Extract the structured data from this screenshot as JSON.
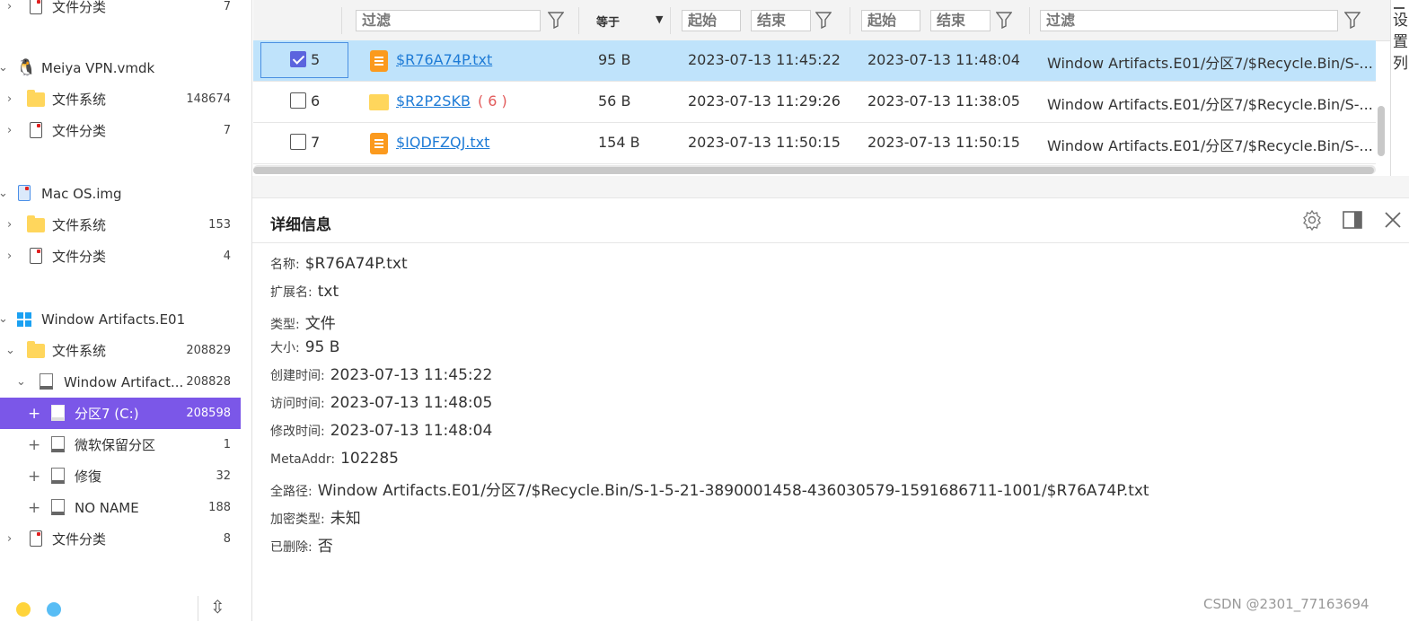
{
  "sidebar": {
    "items": [
      {
        "label": "文件分类",
        "count": "7"
      },
      {
        "label": "Meiya VPN.vmdk"
      },
      {
        "label": "文件系统",
        "count": "148674"
      },
      {
        "label": "文件分类",
        "count": "7"
      },
      {
        "label": "Mac OS.img"
      },
      {
        "label": "文件系统",
        "count": "153"
      },
      {
        "label": "文件分类",
        "count": "4"
      },
      {
        "label": "Window Artifacts.E01"
      },
      {
        "label": "文件系统",
        "count": "208829"
      },
      {
        "label": "Window Artifact...",
        "count": "208828"
      },
      {
        "label": "分区7  (C:)",
        "count": "208598"
      },
      {
        "label": "微软保留分区",
        "count": "1"
      },
      {
        "label": "修復",
        "count": "32"
      },
      {
        "label": "NO NAME",
        "count": "188"
      },
      {
        "label": "文件分类",
        "count": "8"
      }
    ],
    "expand_plus": "+",
    "collapse_icon": "⇳"
  },
  "filters": {
    "name_placeholder": "过滤",
    "size_op": "等于",
    "created_start": "起始",
    "created_end": "结束",
    "accessed_start": "起始",
    "accessed_end": "结束",
    "path_placeholder": "过滤"
  },
  "rows": [
    {
      "index": "5",
      "name": "$R76A74P.txt",
      "badge": "",
      "size": "95 B",
      "created": "2023-07-13 11:45:22",
      "modified": "2023-07-13 11:48:04",
      "path": "Window Artifacts.E01/分区7/$Recycle.Bin/S-..."
    },
    {
      "index": "6",
      "name": "$R2P2SKB",
      "badge": "( 6 )",
      "size": "56 B",
      "created": "2023-07-13 11:29:26",
      "modified": "2023-07-13 11:38:05",
      "path": "Window Artifacts.E01/分区7/$Recycle.Bin/S-..."
    },
    {
      "index": "7",
      "name": "$IQDFZQJ.txt",
      "badge": "",
      "size": "154 B",
      "created": "2023-07-13 11:50:15",
      "modified": "2023-07-13 11:50:15",
      "path": "Window Artifacts.E01/分区7/$Recycle.Bin/S-..."
    }
  ],
  "right_panel": {
    "chars": [
      "设",
      "置",
      "列"
    ]
  },
  "detail": {
    "title": "详细信息",
    "fields": [
      {
        "k": "名称:",
        "v": "$R76A74P.txt"
      },
      {
        "k": "扩展名:",
        "v": "txt"
      },
      {
        "k": "类型:",
        "v": "文件"
      },
      {
        "k": "大小:",
        "v": "95 B"
      },
      {
        "k": "创建时间:",
        "v": "2023-07-13 11:45:22"
      },
      {
        "k": "访问时间:",
        "v": "2023-07-13 11:48:05"
      },
      {
        "k": "修改时间:",
        "v": "2023-07-13 11:48:04"
      },
      {
        "k": "MetaAddr:",
        "v": "102285"
      },
      {
        "k": "全路径:",
        "v": "Window Artifacts.E01/分区7/$Recycle.Bin/S-1-5-21-3890001458-436030579-1591686711-1001/$R76A74P.txt"
      },
      {
        "k": "加密类型:",
        "v": "未知"
      },
      {
        "k": "已删除:",
        "v": "否"
      }
    ]
  },
  "watermark": "CSDN @2301_77163694",
  "colors": {
    "selected_tree": "#7b57e8",
    "selected_row": "#bfe3fb",
    "link": "#1e7bd6",
    "checkbox": "#5b64de"
  }
}
